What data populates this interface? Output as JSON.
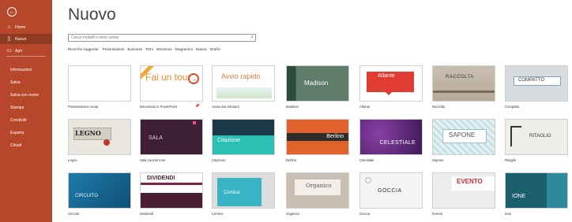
{
  "sidebar": {
    "back_icon": "back-arrow-icon",
    "items": [
      {
        "label": "Home",
        "icon": "home-icon"
      },
      {
        "label": "Nuovo",
        "icon": "new-doc-icon"
      },
      {
        "label": "Apri",
        "icon": "open-folder-icon"
      }
    ],
    "text_items": [
      "Informazioni",
      "Salva",
      "Salva con nome",
      "Stampa",
      "Condividi",
      "Esporta",
      "Chiudi"
    ],
    "accent": "#b7472a"
  },
  "main": {
    "title": "Nuovo",
    "search_placeholder": "Cerca modelli e temi online",
    "suggestions_label": "Ricerche suggerite:",
    "suggestions": [
      "Presentazioni",
      "Business",
      "Temi",
      "Istruzione",
      "Diagrammi",
      "Natura",
      "Grafici"
    ]
  },
  "templates": [
    {
      "caption": "Presentazione vuota",
      "thumb_text": ""
    },
    {
      "caption": "Benvenuto in PowerPoint",
      "thumb_text": "Fai un tour",
      "pin": "📌"
    },
    {
      "caption": "Avvia una struttura",
      "thumb_text": "Avvio rapido"
    },
    {
      "caption": "Madison",
      "thumb_text": "Madison"
    },
    {
      "caption": "Atlante",
      "thumb_text": "Atlante"
    },
    {
      "caption": "Raccolta",
      "thumb_text": "RACCOLTA"
    },
    {
      "caption": "Compatto",
      "thumb_text": "COMPATTO"
    },
    {
      "caption": "Legno",
      "thumb_text": "LEGNO"
    },
    {
      "caption": "Sala riunioni Ione",
      "thumb_text": "SALA"
    },
    {
      "caption": "Citazione",
      "thumb_text": "Citazione"
    },
    {
      "caption": "Berlino",
      "thumb_text": "Berlino"
    },
    {
      "caption": "Celestiale",
      "thumb_text": "CELESTIALE"
    },
    {
      "caption": "Sapone",
      "thumb_text": "SAPONE"
    },
    {
      "caption": "Ritaglio",
      "thumb_text": "RITAGLIO"
    },
    {
      "caption": "Circuito",
      "thumb_text": "CIRCUITO"
    },
    {
      "caption": "Dividendi",
      "thumb_text": "DIVIDENDI"
    },
    {
      "caption": "Cornice",
      "thumb_text": "Cornice"
    },
    {
      "caption": "Organico",
      "thumb_text": "Organico"
    },
    {
      "caption": "Goccia",
      "thumb_text": "GOCCIA"
    },
    {
      "caption": "Evento",
      "thumb_text": "EVENTO"
    },
    {
      "caption": "Ione",
      "thumb_text": "IONE"
    }
  ]
}
